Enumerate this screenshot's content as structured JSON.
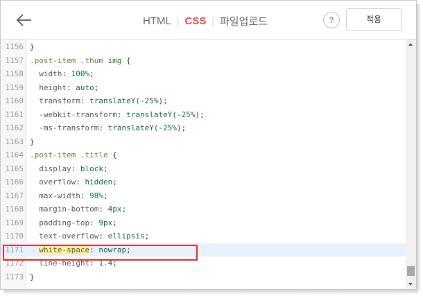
{
  "header": {
    "tabs": [
      {
        "label": "HTML",
        "active": false
      },
      {
        "label": "CSS",
        "active": true
      },
      {
        "label": "파일업로드",
        "active": false
      }
    ],
    "help_label": "?",
    "apply_label": "적용"
  },
  "editor": {
    "highlight_color": "#e02727",
    "lines": [
      {
        "num": "1156",
        "text": "}"
      },
      {
        "num": "1157",
        "text": ".post-item .thum img {"
      },
      {
        "num": "1158",
        "text": "  width: 100%;"
      },
      {
        "num": "1159",
        "text": "  height: auto;"
      },
      {
        "num": "1160",
        "text": "  transform: translateY(-25%);"
      },
      {
        "num": "1161",
        "text": "  -webkit-transform: translateY(-25%);"
      },
      {
        "num": "1162",
        "text": "  -ms-transform: translateY(-25%);"
      },
      {
        "num": "1163",
        "text": "}"
      },
      {
        "num": "1164",
        "text": ".post-item .title {"
      },
      {
        "num": "1165",
        "text": "  display: block;"
      },
      {
        "num": "1166",
        "text": "  overflow: hidden;"
      },
      {
        "num": "1167",
        "text": "  max-width: 98%;"
      },
      {
        "num": "1168",
        "text": "  margin-bottom: 4px;"
      },
      {
        "num": "1169",
        "text": "  padding-top: 9px;"
      },
      {
        "num": "1170",
        "text": "  text-overflow: ellipsis;"
      },
      {
        "num": "1171",
        "text": "  white-space: nowrap;",
        "active": true
      },
      {
        "num": "1172",
        "text": "  line-height: 1.4;"
      },
      {
        "num": "1173",
        "text": "}"
      }
    ]
  }
}
